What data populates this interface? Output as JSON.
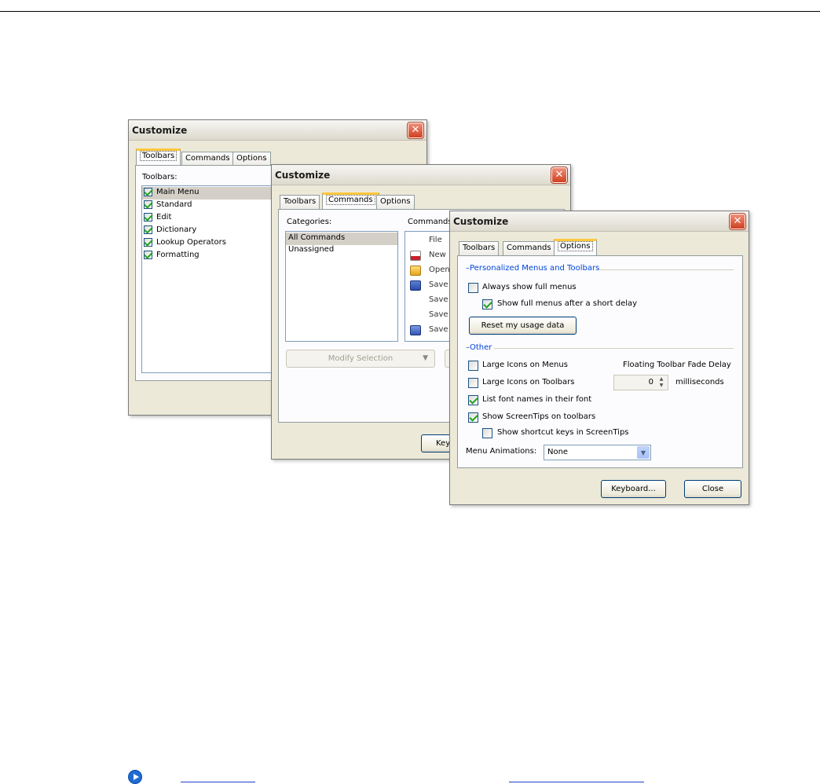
{
  "dialog_title": "Customize",
  "tabs": {
    "toolbars": "Toolbars",
    "commands": "Commands",
    "options": "Options"
  },
  "close_glyph": "✕",
  "toolbars_dialog": {
    "list_label": "Toolbars:",
    "items": [
      {
        "label": "Main Menu",
        "checked": true,
        "selected": true
      },
      {
        "label": "Standard",
        "checked": true
      },
      {
        "label": "Edit",
        "checked": true
      },
      {
        "label": "Dictionary",
        "checked": true
      },
      {
        "label": "Lookup Operators",
        "checked": true
      },
      {
        "label": "Formatting",
        "checked": true
      }
    ]
  },
  "commands_dialog": {
    "categories_label": "Categories:",
    "commands_label": "Commands",
    "categories": [
      "All Commands",
      "Unassigned"
    ],
    "commands": [
      {
        "label": "File",
        "icon": "none"
      },
      {
        "label": "New",
        "icon": "new-doc-icon"
      },
      {
        "label": "Open",
        "icon": "open-folder-icon"
      },
      {
        "label": "Save",
        "icon": "floppy-disk-icon"
      },
      {
        "label": "Save",
        "icon": "none"
      },
      {
        "label": "Save",
        "icon": "none"
      },
      {
        "label": "Save",
        "icon": "save-all-icon"
      }
    ],
    "modify_selection": "Modify Selection",
    "keyboard_partial": "Key"
  },
  "options_dialog": {
    "personalized_header": "Personalized Menus and Toolbars",
    "always_full_menus": "Always show full menus",
    "full_menus_delay": "Show full menus after a short delay",
    "reset_usage": "Reset my usage data",
    "other_header": "Other",
    "large_icons_menus": "Large Icons on Menus",
    "large_icons_toolbars": "Large Icons on Toolbars",
    "fade_delay_label": "Floating Toolbar Fade Delay",
    "fade_delay_value": "0",
    "milliseconds": "milliseconds",
    "list_font_names": "List font names in their font",
    "show_screentips": "Show ScreenTips on toolbars",
    "show_shortcut_keys": "Show shortcut keys in ScreenTips",
    "menu_animations_label": "Menu Animations:",
    "menu_animations_value": "None",
    "keyboard_button": "Keyboard...",
    "close_button": "Close",
    "checks": {
      "always_full_menus": false,
      "full_menus_delay": true,
      "large_icons_menus": false,
      "large_icons_toolbars": false,
      "list_font_names": true,
      "show_screentips": true,
      "show_shortcut_keys": false
    }
  },
  "colors": {
    "dialog_bg": "#ece9d8",
    "group_header": "#0046d5",
    "active_tab_accent": "#ffc73c",
    "close_button": "#d1401f",
    "link": "#1f3fc7",
    "footer_icon": "#1f6bd6"
  }
}
